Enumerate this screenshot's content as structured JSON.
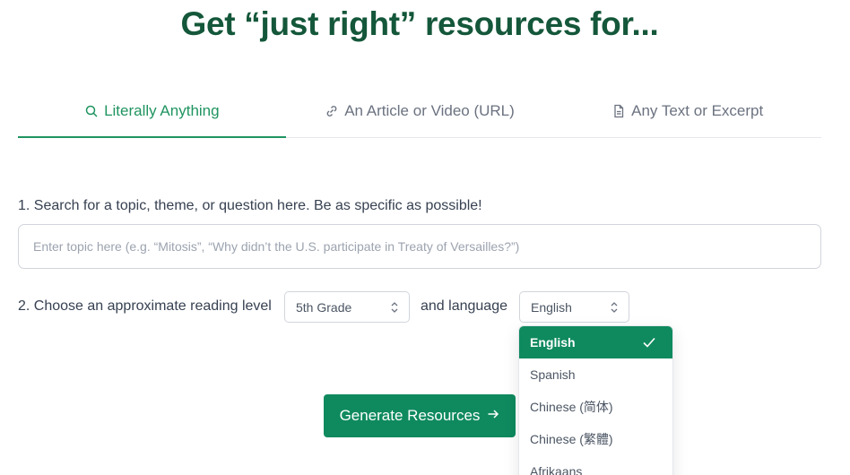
{
  "title": "Get “just right” resources for...",
  "tabs": [
    {
      "label": "Literally Anything",
      "icon": "search-icon",
      "active": true
    },
    {
      "label": "An Article or Video (URL)",
      "icon": "link-icon",
      "active": false
    },
    {
      "label": "Any Text or Excerpt",
      "icon": "document-icon",
      "active": false
    }
  ],
  "step1": {
    "label": "1. Search for a topic, theme, or question here. Be as specific as possible!",
    "placeholder": "Enter topic here (e.g. “Mitosis”, “Why didn’t the U.S. participate in Treaty of Versailles?”)",
    "value": ""
  },
  "step2": {
    "label": "2. Choose an approximate reading level",
    "grade_value": "5th Grade",
    "and_language": "and language",
    "language_value": "English"
  },
  "language_options": [
    "English",
    "Spanish",
    "Chinese (简体)",
    "Chinese (繁體)",
    "Afrikaans"
  ],
  "selected_language": "English",
  "generate_label": "Generate Resources",
  "colors": {
    "accent": "#0f8a5f",
    "title": "#14573a",
    "active_tab": "#1f9460"
  }
}
